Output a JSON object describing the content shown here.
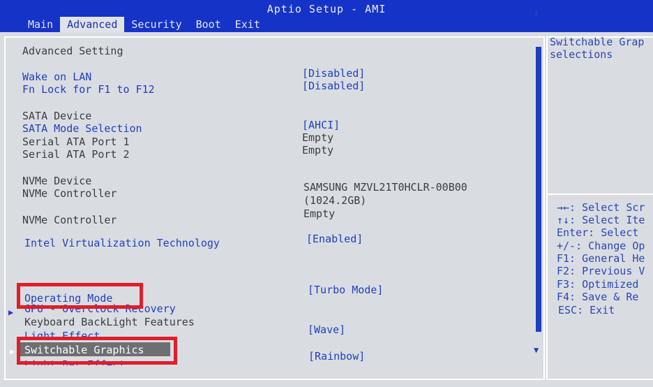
{
  "window": {
    "title": "Aptio Setup - AMI"
  },
  "tabs": [
    "Main",
    "Advanced",
    "Security",
    "Boot",
    "Exit"
  ],
  "main": {
    "heading": "Advanced Setting",
    "wake_on_lan": {
      "label": "Wake on LAN",
      "value": "[Disabled]"
    },
    "fn_lock": {
      "label": "Fn Lock for F1 to F12",
      "value": "[Disabled]"
    },
    "sata_device": "SATA Device",
    "sata_mode": {
      "label": "SATA Mode Selection",
      "value": "[AHCI]"
    },
    "sata_port1": {
      "label": "Serial ATA Port 1",
      "value": "Empty"
    },
    "sata_port2": {
      "label": "Serial ATA Port 2",
      "value": "Empty"
    },
    "nvme_device": "NVMe Device",
    "nvme_controller1": {
      "label": "NVMe Controller",
      "value_line1": "SAMSUNG MZVL21T0HCLR-00B00",
      "value_line2": "(1024.2GB)"
    },
    "nvme_controller2": {
      "label": "NVMe Controller",
      "value": "Empty"
    },
    "virtualization": {
      "label": "Intel Virtualization Technology",
      "value": "[Enabled]"
    },
    "operating_mode": {
      "label": "Operating Mode",
      "value": "[Turbo Mode]"
    },
    "gpu_recovery": {
      "label": "GPU - Overclock Recovery"
    },
    "keyboard_backlight": {
      "label": "Keyboard BackLight Features"
    },
    "light_effect": {
      "label": "Light Effect",
      "value": "[Wave]"
    },
    "switchable_graphics": {
      "label": "Switchable Graphics"
    },
    "light_bar_effect": {
      "label": "Light Bar Effect",
      "value": "[Rainbow]"
    }
  },
  "help": {
    "description_line1": "Switchable Grap",
    "description_line2": "selections",
    "keys": [
      "→←: Select Scr",
      "↑↓: Select Ite",
      "Enter: Select",
      "+/-: Change Op",
      "F1: General He",
      "F2: Previous V",
      "F3: Optimized",
      "F4: Save & Re",
      "ESC: Exit"
    ]
  },
  "colors": {
    "bios_blue": "#1633c7",
    "panel_gray": "#d9dde2",
    "highlight": "#e11d2a"
  }
}
